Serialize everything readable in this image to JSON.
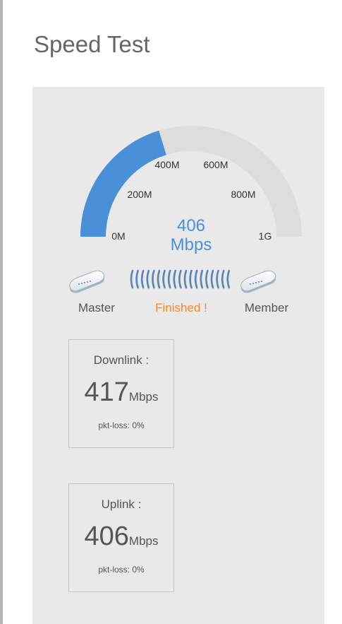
{
  "page": {
    "title": "Speed Test"
  },
  "gauge": {
    "value_mbps": 406,
    "max_mbps": 1000,
    "readout_value": "406",
    "readout_unit": "Mbps",
    "ticks": [
      "0M",
      "200M",
      "400M",
      "600M",
      "800M",
      "1G"
    ],
    "fill_color": "#4a90d9",
    "track_color": "#dddddd"
  },
  "devices": {
    "master_label": "Master",
    "member_label": "Member",
    "status": "Finished !",
    "status_color": "#f08a2c"
  },
  "downlink": {
    "title": "Downlink :",
    "value": "417",
    "unit": "Mbps",
    "pkt_loss": "pkt-loss: 0%"
  },
  "uplink": {
    "title": "Uplink :",
    "value": "406",
    "unit": "Mbps",
    "pkt_loss": "pkt-loss: 0%"
  }
}
